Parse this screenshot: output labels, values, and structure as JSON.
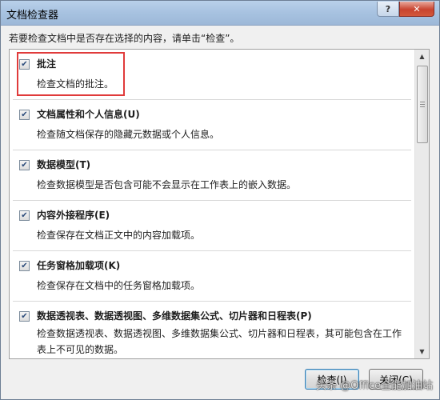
{
  "window": {
    "title": "文档检查器",
    "help_glyph": "?",
    "close_glyph": "✕"
  },
  "instruction": "若要检查文档中是否存在选择的内容，请单击“检查”。",
  "items": [
    {
      "title": "批注",
      "desc": "检查文档的批注。",
      "checked": true
    },
    {
      "title": "文档属性和个人信息(U)",
      "desc": "检查随文档保存的隐藏元数据或个人信息。",
      "checked": true
    },
    {
      "title": "数据模型(T)",
      "desc": "检查数据模型是否包含可能不会显示在工作表上的嵌入数据。",
      "checked": true
    },
    {
      "title": "内容外接程序(E)",
      "desc": "检查保存在文档正文中的内容加载项。",
      "checked": true
    },
    {
      "title": "任务窗格加载项(K)",
      "desc": "检查保存在文档中的任务窗格加载项。",
      "checked": true
    },
    {
      "title": "数据透视表、数据透视图、多维数据集公式、切片器和日程表(P)",
      "desc": "检查数据透视表、数据透视图、多维数据集公式、切片器和日程表，其可能包含在工作表上不可见的数据。",
      "checked": true
    }
  ],
  "check_glyph": "✔",
  "buttons": {
    "inspect": "检查(I)",
    "close": "关闭(C)"
  },
  "watermark": "头条 @Office全能加油站"
}
